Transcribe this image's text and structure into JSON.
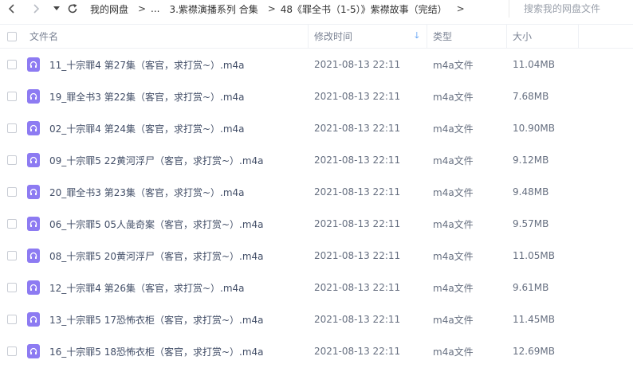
{
  "topbar": {
    "back_glyph": "‹",
    "forward_glyph": "›",
    "history_glyph": "▾",
    "breadcrumbs": [
      "我的网盘",
      "...",
      "3.紫襟演播系列 合集",
      "48《罪全书（1-5）》紫襟故事（完结）"
    ],
    "search_placeholder": "搜索我的网盘文件"
  },
  "header": {
    "name": "文件名",
    "time": "修改时间",
    "type": "类型",
    "size": "大小"
  },
  "colors": {
    "file_icon": "#8d7bf2",
    "sort_arrow": "#3b8cf3"
  },
  "files": [
    {
      "name": "11_十宗罪4 第27集（客官，求打赏~）.m4a",
      "time": "2021-08-13 22:11",
      "type": "m4a文件",
      "size": "11.04MB"
    },
    {
      "name": "19_罪全书3 第22集（客官，求打赏~）.m4a",
      "time": "2021-08-13 22:11",
      "type": "m4a文件",
      "size": "7.68MB"
    },
    {
      "name": "02_十宗罪4 第24集（客官，求打赏~）.m4a",
      "time": "2021-08-13 22:11",
      "type": "m4a文件",
      "size": "10.90MB"
    },
    {
      "name": "09_十宗罪5 22黄河浮尸（客官，求打赏~）.m4a",
      "time": "2021-08-13 22:11",
      "type": "m4a文件",
      "size": "9.12MB"
    },
    {
      "name": "20_罪全书3 第23集（客官，求打赏~）.m4a",
      "time": "2021-08-13 22:11",
      "type": "m4a文件",
      "size": "9.48MB"
    },
    {
      "name": "06_十宗罪5 05人彘奇案（客官，求打赏~）.m4a",
      "time": "2021-08-13 22:11",
      "type": "m4a文件",
      "size": "9.57MB"
    },
    {
      "name": "08_十宗罪5 20黄河浮尸（客官，求打赏~）.m4a",
      "time": "2021-08-13 22:11",
      "type": "m4a文件",
      "size": "11.05MB"
    },
    {
      "name": "12_十宗罪4 第26集（客官，求打赏~）.m4a",
      "time": "2021-08-13 22:11",
      "type": "m4a文件",
      "size": "9.61MB"
    },
    {
      "name": "13_十宗罪5 17恐怖衣柜（客官，求打赏~）.m4a",
      "time": "2021-08-13 22:11",
      "type": "m4a文件",
      "size": "11.45MB"
    },
    {
      "name": "16_十宗罪5 18恐怖衣柜（客官，求打赏~）.m4a",
      "time": "2021-08-13 22:11",
      "type": "m4a文件",
      "size": "12.69MB"
    }
  ]
}
